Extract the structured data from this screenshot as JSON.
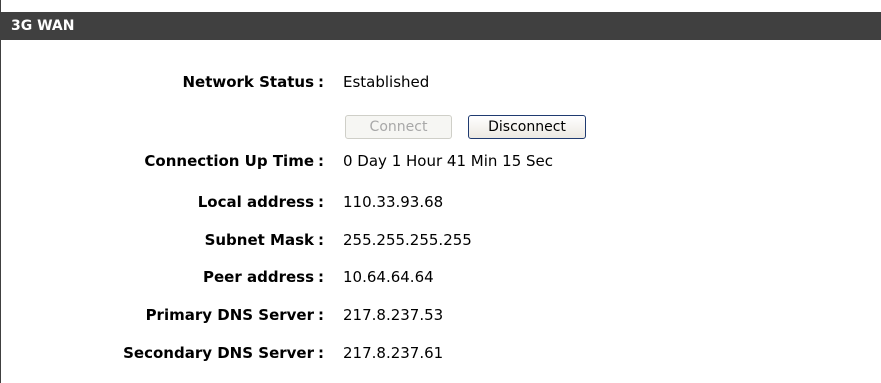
{
  "header": {
    "title": "3G WAN"
  },
  "status": {
    "rows": [
      {
        "label": "Network Status",
        "value": "Established"
      },
      {
        "label": "Connection Up Time",
        "value": "0 Day 1 Hour 41 Min 15 Sec"
      },
      {
        "label": "Local address",
        "value": "110.33.93.68"
      },
      {
        "label": "Subnet Mask",
        "value": "255.255.255.255"
      },
      {
        "label": "Peer address",
        "value": "10.64.64.64"
      },
      {
        "label": "Primary DNS Server",
        "value": "217.8.237.53"
      },
      {
        "label": "Secondary DNS Server",
        "value": "217.8.237.61"
      }
    ],
    "separator": ":"
  },
  "buttons": {
    "connect_label": "Connect",
    "connect_enabled": false,
    "disconnect_label": "Disconnect",
    "disconnect_enabled": true
  },
  "colors": {
    "header_bg": "#404040",
    "header_text": "#ffffff",
    "disabled_text": "#a8a8a8"
  }
}
